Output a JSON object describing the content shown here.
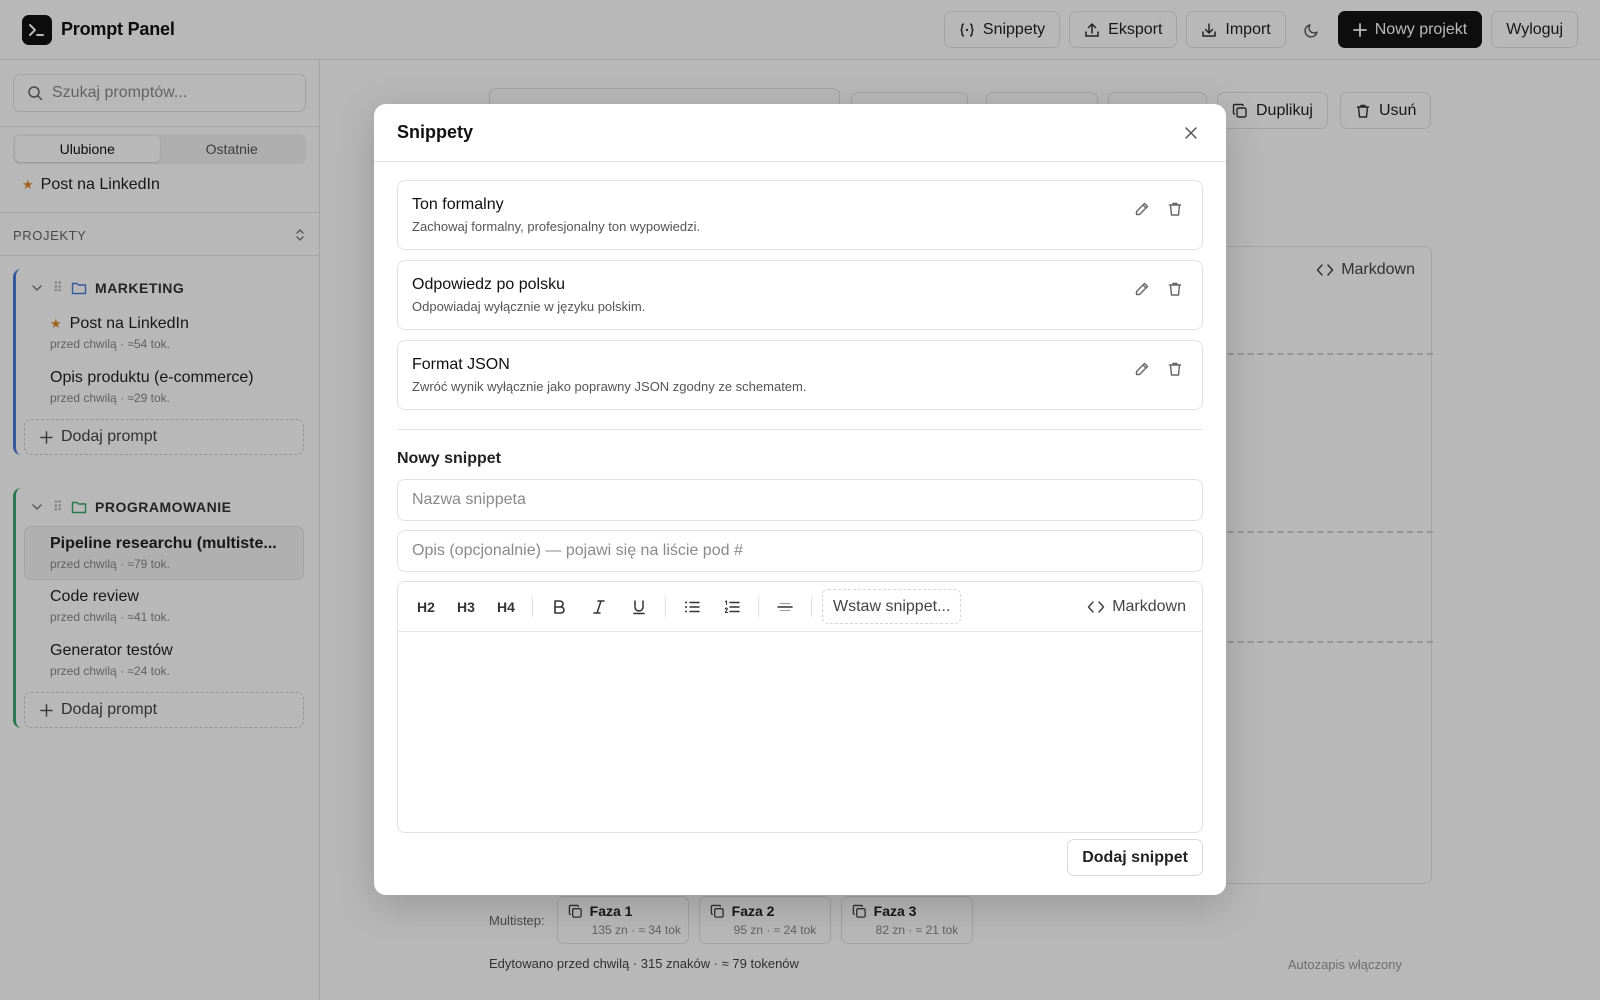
{
  "app": {
    "title": "Prompt Panel"
  },
  "header": {
    "snippets": "Snippety",
    "export": "Eksport",
    "import": "Import",
    "new_project": "Nowy projekt",
    "logout": "Wyloguj"
  },
  "sidebar": {
    "search_placeholder": "Szukaj promptów...",
    "tabs": {
      "favorites": "Ulubione",
      "recent": "Ostatnie"
    },
    "favorite_item": "Post na LinkedIn",
    "projects_label": "PROJEKTY",
    "groups": [
      {
        "name": "MARKETING",
        "color": "#4a7fd9",
        "items": [
          {
            "title": "Post na LinkedIn",
            "meta": "przed chwilą · ≈54 tok.",
            "starred": true
          },
          {
            "title": "Opis produktu (e-commerce)",
            "meta": "przed chwilą · ≈29 tok.",
            "starred": false
          }
        ],
        "add_label": "Dodaj prompt"
      },
      {
        "name": "PROGRAMOWANIE",
        "color": "#3aa76d",
        "items": [
          {
            "title": "Pipeline researchu (multiste...",
            "meta": "przed chwilą · ≈79 tok.",
            "active": true
          },
          {
            "title": "Code review",
            "meta": "przed chwilą · ≈41 tok."
          },
          {
            "title": "Generator testów",
            "meta": "przed chwilą · ≈24 tok."
          }
        ],
        "add_label": "Dodaj prompt"
      }
    ]
  },
  "main": {
    "toolbar": {
      "duplicate": "Duplikuj",
      "delete": "Usuń"
    },
    "markdown_label": "Markdown",
    "multistep_label": "Multistep:",
    "phases": [
      {
        "name": "Faza 1",
        "meta": "135 zn · ≈ 34 tok"
      },
      {
        "name": "Faza 2",
        "meta": "95 zn · ≈ 24 tok"
      },
      {
        "name": "Faza 3",
        "meta": "82 zn · ≈ 21 tok"
      }
    ],
    "status": "Edytowano przed chwilą · 315 znaków · ≈ 79 tokenów",
    "autosave": "Autozapis włączony"
  },
  "modal": {
    "title": "Snippety",
    "snippets": [
      {
        "name": "Ton formalny",
        "desc": "Zachowaj formalny, profesjonalny ton wypowiedzi."
      },
      {
        "name": "Odpowiedz po polsku",
        "desc": "Odpowiadaj wyłącznie w języku polskim."
      },
      {
        "name": "Format JSON",
        "desc": "Zwróć wynik wyłącznie jako poprawny JSON zgodny ze schematem."
      }
    ],
    "new_label": "Nowy snippet",
    "name_placeholder": "Nazwa snippeta",
    "desc_placeholder": "Opis (opcjonalnie) — pojawi się na liście pod #",
    "toolbar": {
      "h2": "H2",
      "h3": "H3",
      "h4": "H4",
      "insert": "Wstaw snippet...",
      "markdown": "Markdown"
    },
    "add_button": "Dodaj snippet"
  }
}
